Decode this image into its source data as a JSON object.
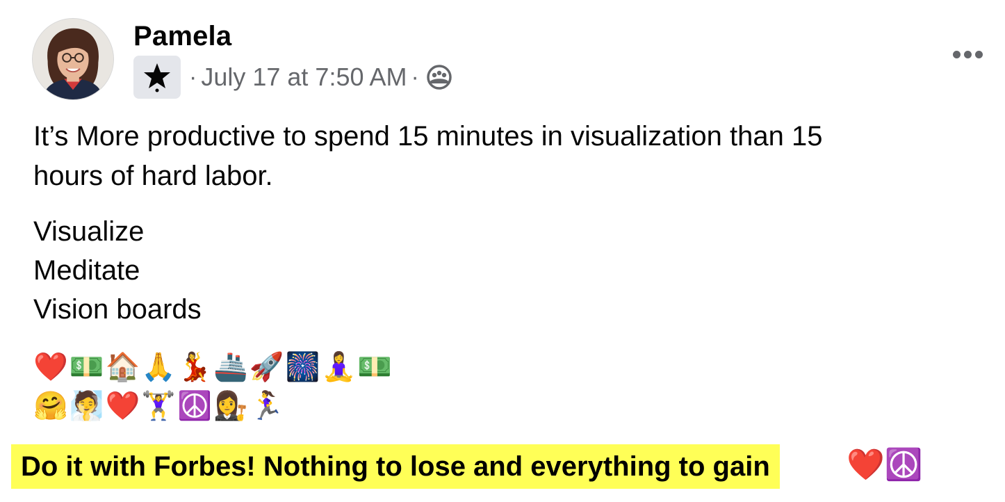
{
  "post": {
    "author": "Pamela",
    "badge_icon": "star-badge-icon",
    "timestamp": "July 17 at 7:50 AM",
    "separator": "·",
    "audience_icon": "group-audience-icon",
    "more_icon": "more-options-icon",
    "body": {
      "line1": "It’s More productive to spend 15 minutes in visualization than 15",
      "line2": "hours of hard labor.",
      "list": [
        "Visualize",
        "Meditate",
        "Vision boards"
      ],
      "emoji_row1": "❤️💵🏠🙏💃🚢🚀🎆🧘‍♀️💵",
      "emoji_row2": "🤗🧖❤️🏋️‍♀️☮️👩‍⚖️🏃‍♀️"
    }
  },
  "banner": {
    "text": "Do it with Forbes! Nothing to lose and everything to gain",
    "background": "#ffff57",
    "emojis": "❤️☮️"
  }
}
